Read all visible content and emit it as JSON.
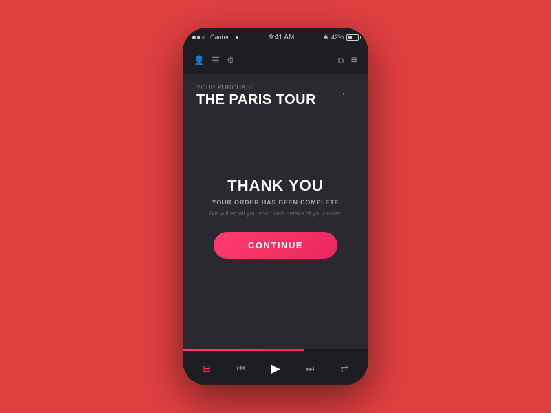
{
  "background": {
    "color": "#e04040"
  },
  "phone": {
    "status_bar": {
      "dots": [
        "dot1",
        "dot2",
        "dot3"
      ],
      "carrier": "Carrier",
      "wifi": "wifi",
      "time": "9:41 AM",
      "bluetooth": "42%",
      "battery_level": 42
    },
    "toolbar": {
      "left_icons": [
        "person-icon",
        "list-icon",
        "gear-icon"
      ],
      "right_icons": [
        "copy-icon",
        "menu-icon"
      ]
    },
    "content": {
      "purchase_label": "YOUR PURCHASE",
      "tour_name": "THE PARIS TOUR",
      "back_button_label": "←",
      "thank_you": {
        "title": "THANK YOU",
        "order_complete": "YOUR ORDER HAS BEEN COMPLETE",
        "sub_text": "We will email you soon with details of your order."
      },
      "continue_button": "CONTINUE"
    },
    "progress": {
      "fill_percent": 65
    },
    "player": {
      "icons": [
        {
          "name": "playlist-icon",
          "symbol": "☰",
          "active": true
        },
        {
          "name": "prev-icon",
          "symbol": "⏮"
        },
        {
          "name": "play-icon",
          "symbol": "▶"
        },
        {
          "name": "next-icon",
          "symbol": "⏭"
        },
        {
          "name": "shuffle-icon",
          "symbol": "⇄"
        }
      ]
    }
  }
}
